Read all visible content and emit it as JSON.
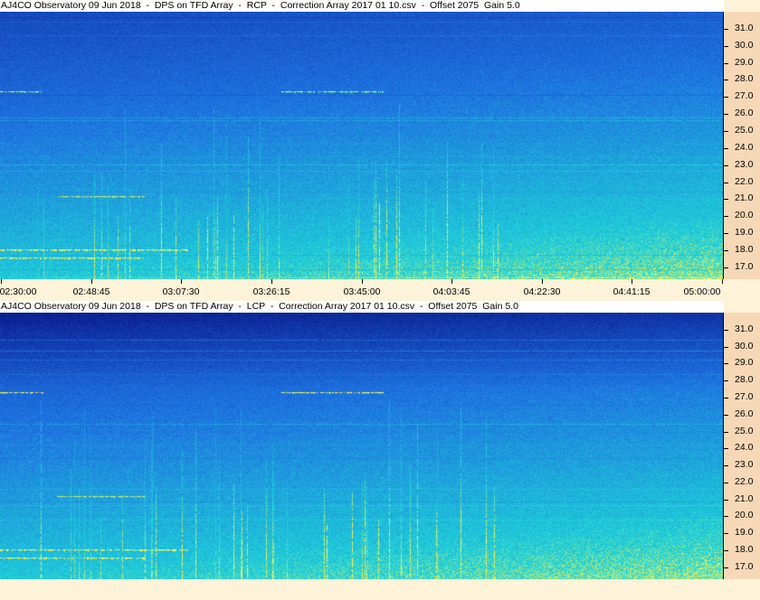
{
  "panels": [
    {
      "id": "rcp",
      "title": "AJ4CO Observatory 09 Jun 2018  -  DPS on TFD Array  -  RCP  -  Correction Array 2017 01 10.csv  -  Offset 2075  Gain 5.0",
      "polarization": "RCP"
    },
    {
      "id": "lcp",
      "title": "AJ4CO Observatory 09 Jun 2018  -  DPS on TFD Array  -  LCP  -  Correction Array 2017 01 10.csv  -  Offset 2075  Gain 5.0",
      "polarization": "LCP"
    }
  ],
  "time_axis": {
    "labels": [
      "02:30:00",
      "02:48:45",
      "03:07:30",
      "03:26:15",
      "03:45:00",
      "04:03:45",
      "04:22:30",
      "04:41:15",
      "05:00:00"
    ]
  },
  "colors": {
    "low": "#0a1a8c",
    "mid": "#1e6fe0",
    "high": "#1fd6d8",
    "burst": "#f2f25a",
    "axis_bg": "#f7d8b6",
    "page_bg": "#fdf3d8"
  },
  "chart_data": [
    {
      "type": "heatmap",
      "title": "AJ4CO Observatory 09 Jun 2018  -  DPS on TFD Array  -  RCP  -  Correction Array 2017 01 10.csv  -  Offset 2075  Gain 5.0",
      "x_ticks": [
        "02:30:00",
        "02:48:45",
        "03:07:30",
        "03:26:15",
        "03:45:00",
        "04:03:45",
        "04:22:30",
        "04:41:15",
        "05:00:00"
      ],
      "y_ticks": [
        31.0,
        30.0,
        29.0,
        28.0,
        27.0,
        26.0,
        25.0,
        24.0,
        23.0,
        22.0,
        21.0,
        20.0,
        19.0,
        18.0,
        17.0
      ],
      "ylim": [
        16.3,
        32.0
      ]
    },
    {
      "type": "heatmap",
      "title": "AJ4CO Observatory 09 Jun 2018  -  DPS on TFD Array  -  LCP  -  Correction Array 2017 01 10.csv  -  Offset 2075  Gain 5.0",
      "y_ticks": [
        31.0,
        30.0,
        29.0,
        28.0,
        27.0,
        26.0,
        25.0,
        24.0,
        23.0,
        22.0,
        21.0,
        20.0,
        19.0,
        18.0,
        17.0
      ],
      "ylim": [
        16.3,
        32.0
      ]
    }
  ]
}
